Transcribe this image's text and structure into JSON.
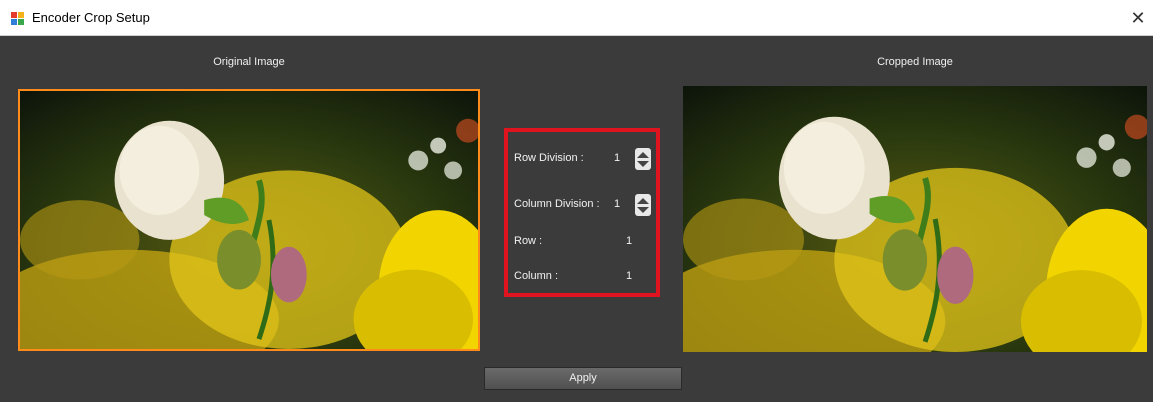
{
  "window": {
    "title": "Encoder Crop Setup",
    "close_glyph": "✕"
  },
  "labels": {
    "original": "Original Image",
    "cropped": "Cropped Image"
  },
  "controls": {
    "row_division_label": "Row Division :",
    "row_division_value": "1",
    "column_division_label": "Column Division :",
    "column_division_value": "1",
    "row_label": "Row :",
    "row_value": "1",
    "column_label": "Column :",
    "column_value": "1"
  },
  "apply_label": "Apply",
  "colors": {
    "selection_border": "#ff8c1a",
    "panel_highlight": "#e0141e",
    "background": "#3b3b3b"
  },
  "icons": [
    "app-icon",
    "close-icon",
    "spin-up-icon",
    "spin-down-icon"
  ]
}
